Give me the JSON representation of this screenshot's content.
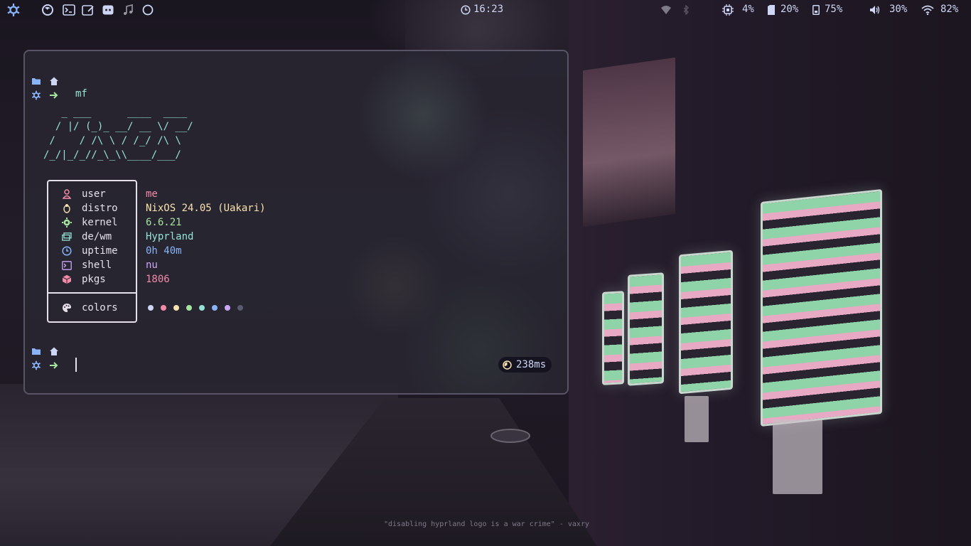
{
  "topbar": {
    "workspace_icon": "nix-snowflake-icon",
    "apps": [
      {
        "icon": "firefox-icon"
      },
      {
        "icon": "terminal-icon"
      },
      {
        "icon": "notes-icon"
      },
      {
        "icon": "discord-icon"
      },
      {
        "icon": "music-icon"
      },
      {
        "icon": "circle-icon"
      }
    ],
    "clock": "16:23",
    "status": {
      "cpu": "4%",
      "memory": "20%",
      "disk": "75%",
      "volume": "30%",
      "wifi": "82%"
    }
  },
  "terminal": {
    "command": "mf",
    "ascii_art": "   _ ___      ____  ____\n  / |/ (_)_ __/ __ \\/ __/\n /    / /\\ \\ / /_/ /\\ \\\n/_/|_/_//_\\_\\\\____/___/",
    "info": [
      {
        "label": "user",
        "value": "me",
        "icon": "user-icon"
      },
      {
        "label": "distro",
        "value": "NixOS 24.05 (Uakari)",
        "icon": "linux-icon"
      },
      {
        "label": "kernel",
        "value": "6.6.21",
        "icon": "gear-icon"
      },
      {
        "label": "de/wm",
        "value": "Hyprland",
        "icon": "window-icon"
      },
      {
        "label": "uptime",
        "value": "0h 40m",
        "icon": "clock-icon"
      },
      {
        "label": "shell",
        "value": "nu",
        "icon": "terminal-icon"
      },
      {
        "label": "pkgs",
        "value": "1806",
        "icon": "package-icon"
      }
    ],
    "colors_label": "colors",
    "palette": [
      "#cdd6f4",
      "#f38ba8",
      "#f9e2af",
      "#a6e3a1",
      "#94e2d5",
      "#89b4fa",
      "#cba6f7",
      "#585b70"
    ],
    "timer": "238ms"
  },
  "desktop": {
    "quote": "\"disabling hyprland logo is a war crime\" - vaxry"
  },
  "colors": {
    "accent_blue": "#89b4fa",
    "accent_green": "#a6e3a1",
    "accent_teal": "#94e2d5",
    "accent_pink": "#f38ba8",
    "accent_yellow": "#f9e2af",
    "accent_purple": "#cba6f7"
  }
}
